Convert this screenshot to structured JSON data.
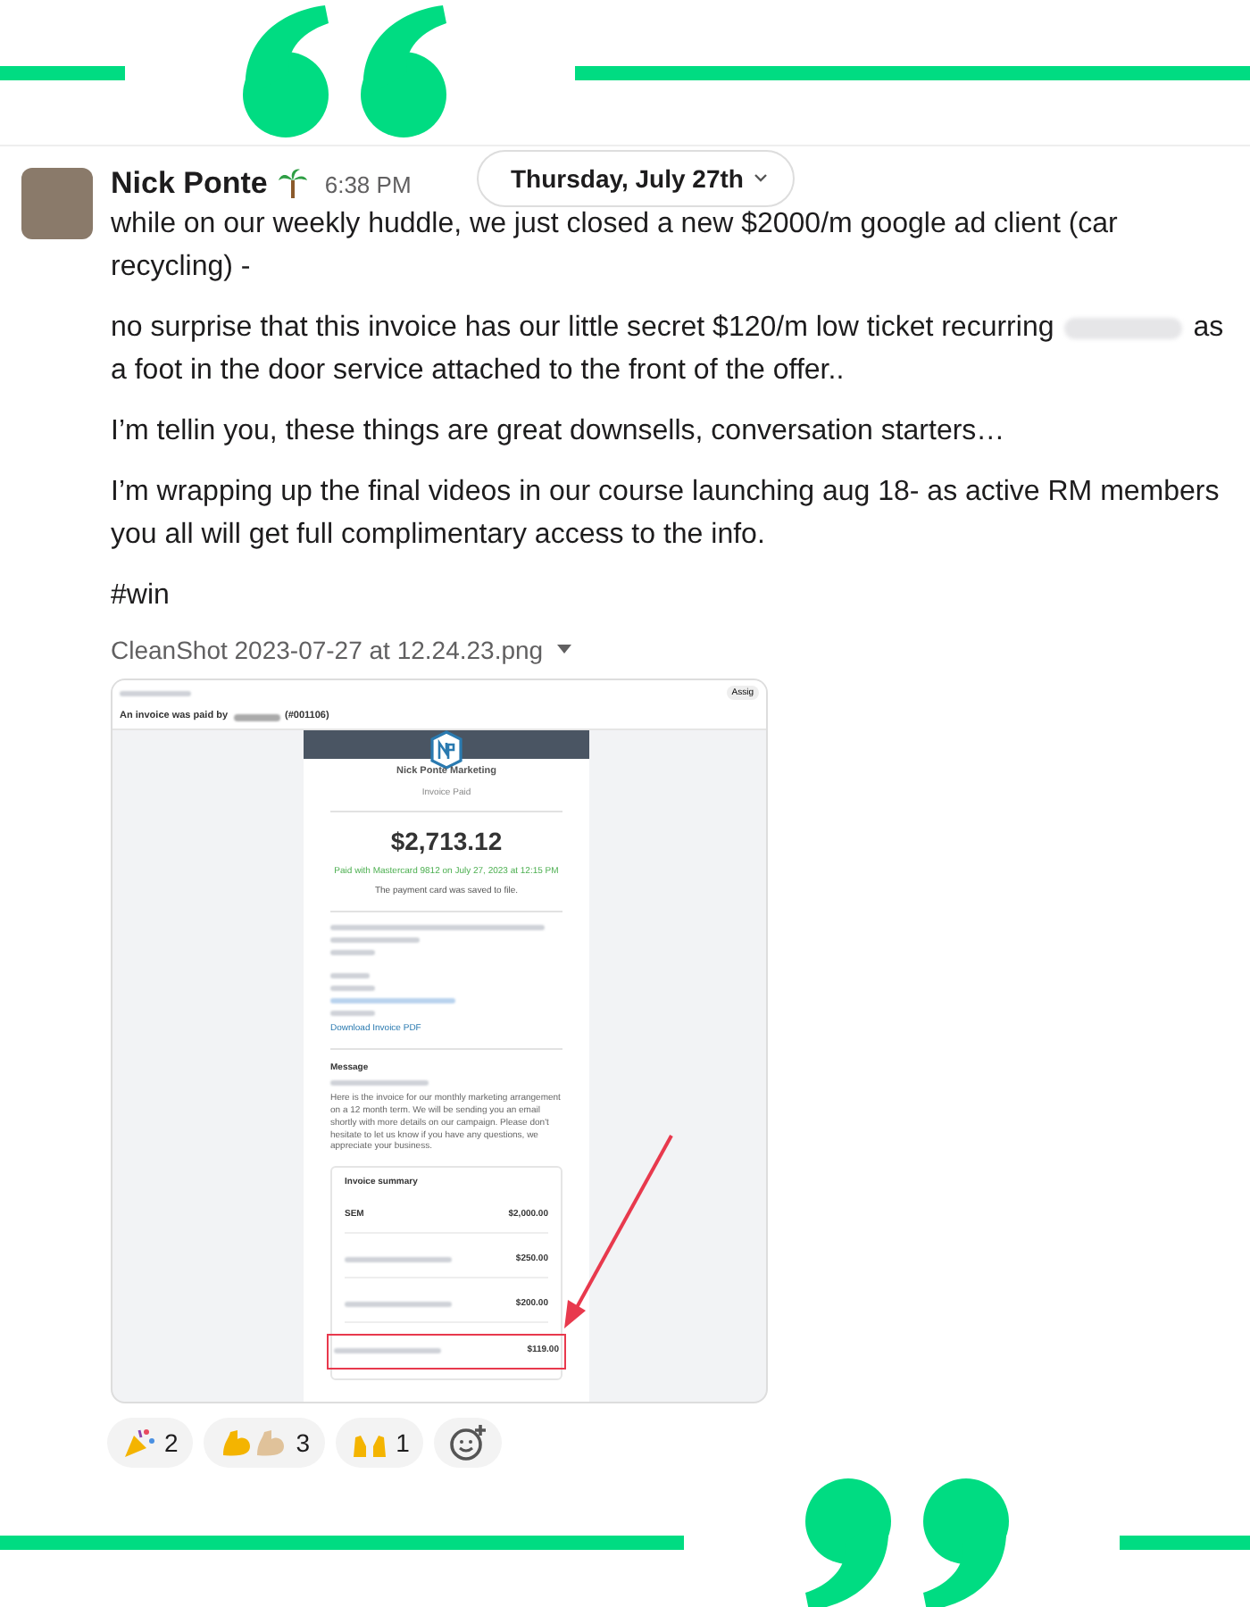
{
  "message": {
    "author": "Nick Ponte",
    "time": "6:38 PM",
    "date_pill": "Thursday, July 27th",
    "paragraphs": [
      {
        "parts": [
          {
            "kind": "text",
            "text": "while on our weekly huddle, we just closed a new $2000/m google ad client (car recycling) -"
          }
        ]
      },
      {
        "parts": [
          {
            "kind": "text",
            "text": "no surprise that this invoice has our little secret $120/m low ticket recurring"
          },
          {
            "kind": "redacted"
          },
          {
            "kind": "text",
            "text": "as a foot in the door service attached to the front of the offer.."
          }
        ]
      },
      {
        "parts": [
          {
            "kind": "text",
            "text": "I’m tellin you, these things are great downsells, conversation starters…"
          }
        ]
      },
      {
        "parts": [
          {
            "kind": "text",
            "text": "I’m wrapping up the final videos in our course launching aug 18- as active RM members you all will get full complimentary access to the info."
          }
        ]
      },
      {
        "parts": [
          {
            "kind": "text",
            "text": "#win"
          }
        ]
      }
    ],
    "attachment": {
      "filename": "CleanShot 2023-07-27 at 12.24.23.png",
      "screenshot": {
        "header_title": "An invoice was paid by",
        "header_number": "(#001106)",
        "assign_button": "Assig",
        "invoice": {
          "company": "Nick Ponte Marketing",
          "status": "Invoice Paid",
          "amount": "$2,713.12",
          "paid_line": "Paid with Mastercard 9812 on July 27, 2023 at 12:15 PM",
          "saved_note": "The payment card was saved to file.",
          "download_link": "Download Invoice PDF",
          "message_label": "Message",
          "message_body": "Here is the invoice for our monthly marketing arrangement on a 12 month term. We will be sending you an email shortly with more details on our campaign. Please don't hesitate to let us know if you have any questions, we appreciate your business.",
          "summary_title": "Invoice summary",
          "summary_rows": [
            {
              "kind": "text",
              "label": "SEM",
              "amount": "$2,000.00",
              "highlighted": false
            },
            {
              "kind": "redacted",
              "amount": "$250.00",
              "highlighted": false
            },
            {
              "kind": "redacted",
              "amount": "$200.00",
              "highlighted": false
            },
            {
              "kind": "redacted",
              "amount": "$119.00",
              "highlighted": true
            }
          ]
        }
      }
    },
    "reactions": [
      {
        "kind": "party",
        "count": "2"
      },
      {
        "kind": "flex",
        "count": "3"
      },
      {
        "kind": "raised_hands",
        "count": "1"
      }
    ]
  }
}
